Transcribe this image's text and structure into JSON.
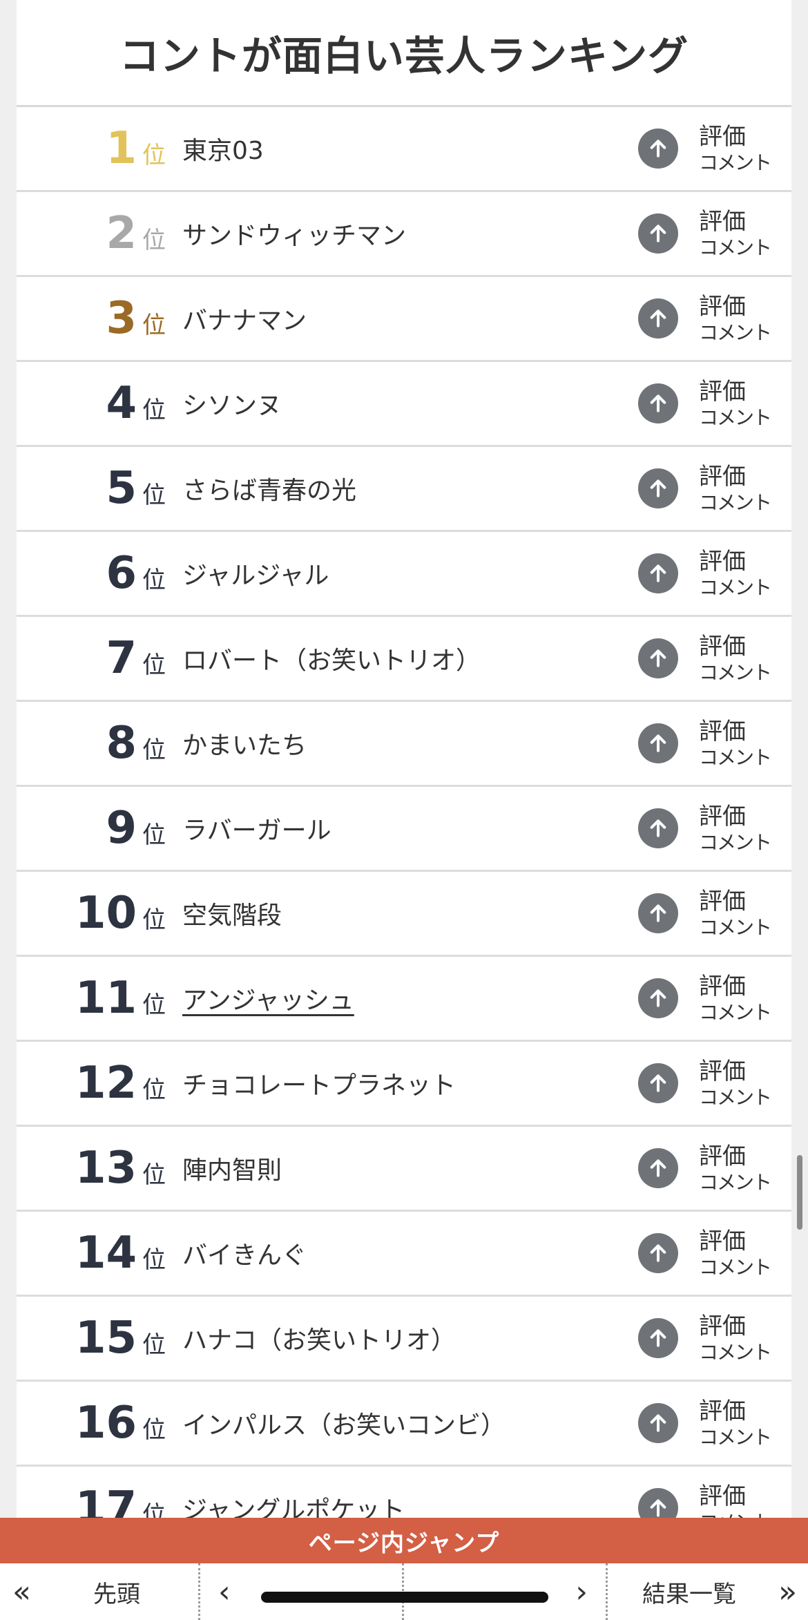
{
  "title": "コントが面白い芸人ランキング",
  "rank_suffix": "位",
  "eval_label": "評価",
  "comment_label": "コメント",
  "rows": [
    {
      "rank": "1",
      "name": "東京03",
      "tier": "gold"
    },
    {
      "rank": "2",
      "name": "サンドウィッチマン",
      "tier": "silver"
    },
    {
      "rank": "3",
      "name": "バナナマン",
      "tier": "bronze"
    },
    {
      "rank": "4",
      "name": "シソンヌ",
      "tier": ""
    },
    {
      "rank": "5",
      "name": "さらば青春の光",
      "tier": ""
    },
    {
      "rank": "6",
      "name": "ジャルジャル",
      "tier": ""
    },
    {
      "rank": "7",
      "name": "ロバート（お笑いトリオ）",
      "tier": ""
    },
    {
      "rank": "8",
      "name": "かまいたち",
      "tier": ""
    },
    {
      "rank": "9",
      "name": "ラバーガール",
      "tier": ""
    },
    {
      "rank": "10",
      "name": "空気階段",
      "tier": ""
    },
    {
      "rank": "11",
      "name": "アンジャッシュ",
      "tier": "",
      "link": true
    },
    {
      "rank": "12",
      "name": "チョコレートプラネット",
      "tier": ""
    },
    {
      "rank": "13",
      "name": "陣内智則",
      "tier": ""
    },
    {
      "rank": "14",
      "name": "バイきんぐ",
      "tier": ""
    },
    {
      "rank": "15",
      "name": "ハナコ（お笑いトリオ）",
      "tier": ""
    },
    {
      "rank": "16",
      "name": "インパルス（お笑いコンビ）",
      "tier": ""
    },
    {
      "rank": "17",
      "name": "ジャングルポケット",
      "tier": ""
    }
  ],
  "jump_bar": {
    "label": "ページ内ジャンプ"
  },
  "nav": {
    "first_arrows": "«",
    "first_label": "先頭",
    "prev": "‹",
    "next": "›",
    "results_label": "結果一覧",
    "last_arrows": "»"
  },
  "colors": {
    "gold": "#e2c25a",
    "silver": "#a8a8a8",
    "bronze": "#9a6a26",
    "jump_bar": "#d35f45",
    "button": "#6f7277"
  },
  "icons": {
    "up_button": "arrow-up-icon"
  }
}
